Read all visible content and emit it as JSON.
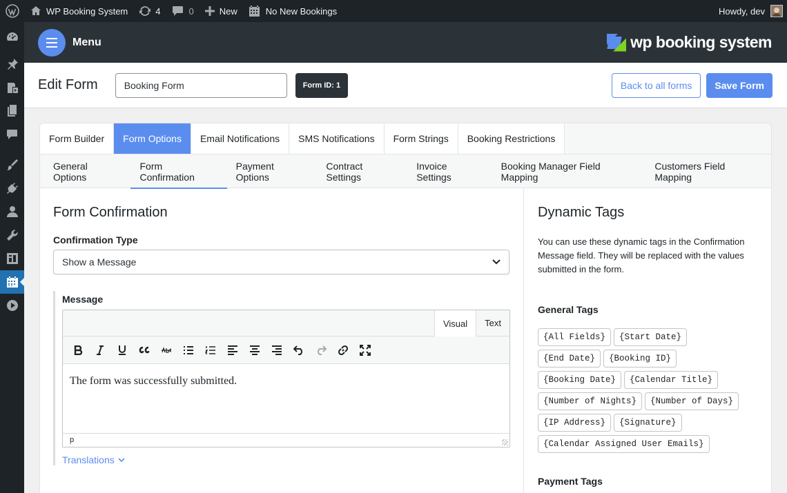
{
  "adminbar": {
    "site_name": "WP Booking System",
    "updates_count": "4",
    "comments_count": "0",
    "new_label": "New",
    "bookings_label": "No New Bookings",
    "howdy": "Howdy, dev"
  },
  "header": {
    "menu_label": "Menu",
    "logo_text": "wp booking system"
  },
  "editbar": {
    "title": "Edit Form",
    "form_name": "Booking Form",
    "form_id": "Form ID: 1",
    "back_label": "Back to all forms",
    "save_label": "Save Form"
  },
  "main_tabs": [
    "Form Builder",
    "Form Options",
    "Email Notifications",
    "SMS Notifications",
    "Form Strings",
    "Booking Restrictions"
  ],
  "sub_tabs": [
    "General Options",
    "Form Confirmation",
    "Payment Options",
    "Contract Settings",
    "Invoice Settings",
    "Booking Manager Field Mapping",
    "Customers Field Mapping"
  ],
  "left": {
    "heading": "Form Confirmation",
    "confirmation_type_label": "Confirmation Type",
    "confirmation_type_value": "Show a Message",
    "message_label": "Message",
    "editor_tab_visual": "Visual",
    "editor_tab_text": "Text",
    "editor_content": "The form was successfully submitted.",
    "editor_status": "p",
    "translations_label": "Translations"
  },
  "right": {
    "heading": "Dynamic Tags",
    "description": "You can use these dynamic tags in the Confirmation Message field. They will be replaced with the values submitted in the form.",
    "general_tags_label": "General Tags",
    "general_tags": [
      "{All Fields}",
      "{Start Date}",
      "{End Date}",
      "{Booking ID}",
      "{Booking Date}",
      "{Calendar Title}",
      "{Number of Nights}",
      "{Number of Days}",
      "{IP Address}",
      "{Signature}",
      "{Calendar Assigned User Emails}"
    ],
    "payment_tags_label": "Payment Tags"
  },
  "colors": {
    "accent": "#5b8def",
    "admin_dark": "#1d2327",
    "header_dark": "#2c3338",
    "wp_blue": "#2271b1"
  }
}
